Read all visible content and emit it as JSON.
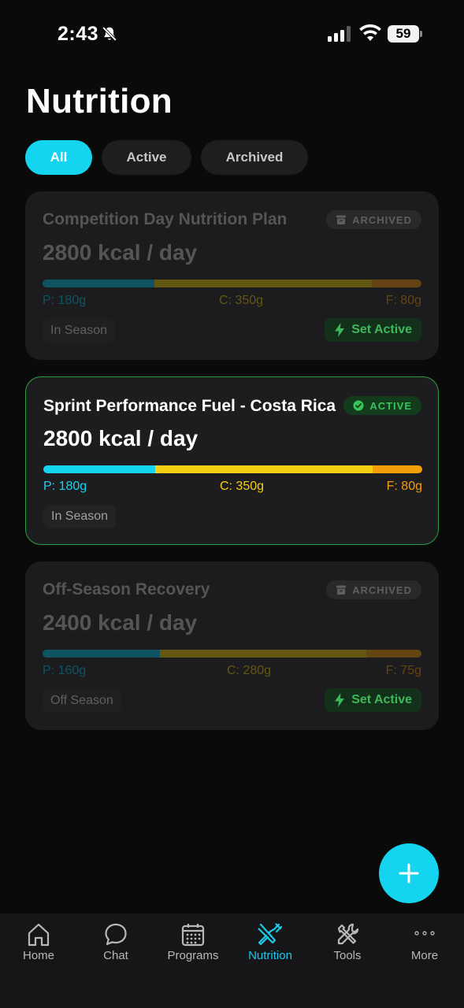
{
  "status_bar": {
    "time": "2:43",
    "battery": "59"
  },
  "page_title": "Nutrition",
  "filters": [
    {
      "label": "All",
      "selected": true
    },
    {
      "label": "Active",
      "selected": false
    },
    {
      "label": "Archived",
      "selected": false
    }
  ],
  "plans": [
    {
      "title": "Competition Day Nutrition Plan",
      "kcal": "2800 kcal / day",
      "status": "ARCHIVED",
      "protein": "P: 180g",
      "carbs": "C: 350g",
      "fat": "F: 80g",
      "macro_split": [
        0.295,
        0.575,
        0.13
      ],
      "season": "In Season",
      "action": "Set Active"
    },
    {
      "title": "Sprint Performance Fuel - Costa Rica",
      "kcal": "2800 kcal / day",
      "status": "ACTIVE",
      "protein": "P: 180g",
      "carbs": "C: 350g",
      "fat": "F: 80g",
      "macro_split": [
        0.295,
        0.575,
        0.13
      ],
      "season": "In Season"
    },
    {
      "title": "Off-Season Recovery",
      "kcal": "2400 kcal / day",
      "status": "ARCHIVED",
      "protein": "P: 160g",
      "carbs": "C: 280g",
      "fat": "F: 75g",
      "macro_split": [
        0.31,
        0.545,
        0.145
      ],
      "season": "Off Season",
      "action": "Set Active"
    }
  ],
  "colors": {
    "accent": "#15d4f0",
    "protein": "#15d4f0",
    "carbs": "#f5cf12",
    "fat": "#f59e0b",
    "active_green": "#38c55a"
  },
  "tabs": [
    {
      "label": "Home",
      "icon": "home-icon"
    },
    {
      "label": "Chat",
      "icon": "chat-icon"
    },
    {
      "label": "Programs",
      "icon": "calendar-icon"
    },
    {
      "label": "Nutrition",
      "icon": "fork-knife-icon",
      "current": true
    },
    {
      "label": "Tools",
      "icon": "tools-icon"
    },
    {
      "label": "More",
      "icon": "more-dots-icon"
    }
  ]
}
